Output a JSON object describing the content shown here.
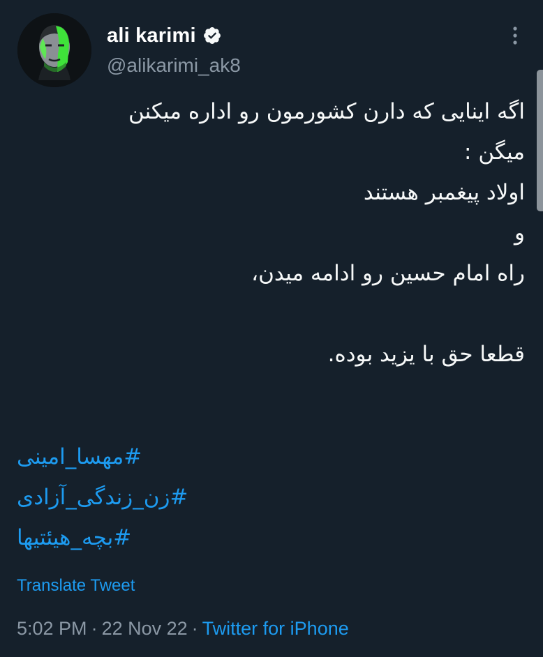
{
  "author": {
    "display_name": "ali karimi",
    "handle": "@alikarimi_ak8",
    "verified": true,
    "avatar_icon": "profile-photo-icon"
  },
  "menu": {
    "icon": "more-vertical-icon"
  },
  "tweet": {
    "lines": [
      "اگه اینایی که دارن کشورمون رو اداره میکنن",
      "میگن :",
      "اولاد پیغمبر هستند",
      "و",
      "راه امام حسین رو ادامه میدن،",
      "",
      "قطعا حق با یزید بوده."
    ],
    "hashtags": [
      "#مهسا_امینی",
      "#زن_زندگی_آزادی",
      "#بچه_هیئتیها"
    ]
  },
  "translate_label": "Translate Tweet",
  "meta": {
    "time": "5:02 PM",
    "date": "22 Nov 22",
    "client": "Twitter for iPhone",
    "separator": "·"
  },
  "colors": {
    "background": "#15202b",
    "text": "#f7f9f9",
    "secondary_text": "#8b98a5",
    "accent": "#1d9bf0"
  }
}
